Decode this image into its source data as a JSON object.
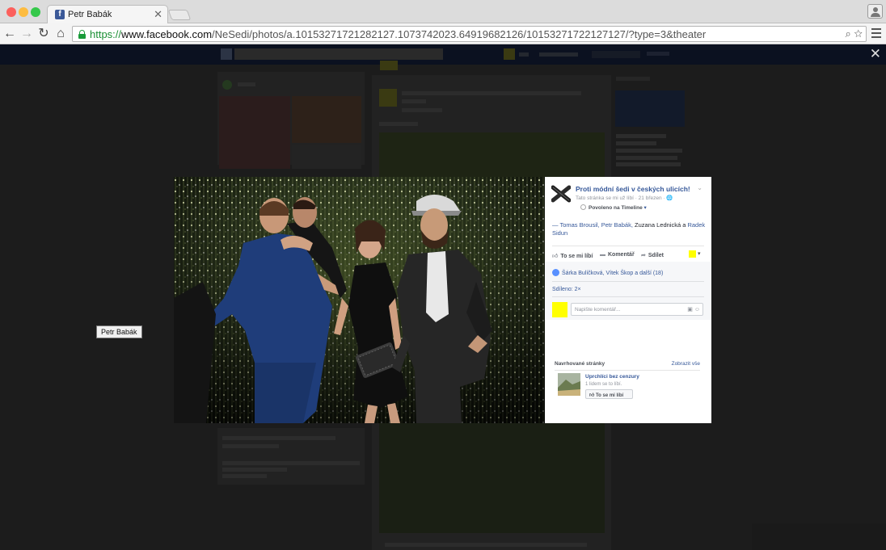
{
  "browser": {
    "tab_title": "Petr Babák",
    "tab_favicon": "f",
    "tab_close": "✕",
    "url_scheme": "https://",
    "url_host": "www.facebook.com",
    "url_path": "/NeSedi/photos/a.10153271721282127.1073742023.64919682126/10153271722127127/?type=3&theater",
    "colors": {
      "secure_green": "#1a9b3a",
      "link_blue": "#365899",
      "traffic_red": "#fc605c",
      "traffic_yellow": "#fdbc40",
      "traffic_green": "#34c84a"
    }
  },
  "icons": {
    "back": "←",
    "forward": "→",
    "reload": "↻",
    "home": "⌂",
    "search": "⌕",
    "bookmark": "☆",
    "close": "✕"
  },
  "page": {
    "name": "Proti módní šedi v českých ulicích!",
    "meta": "Tato stránka se mi už líbí · 21 březen · 🌐",
    "timeline_label": "Povoleno na Timeline",
    "timeline_caret": "▾",
    "tag_prefix": "— ",
    "tagged_links": [
      "Tomas Brousil, Petr Babák,"
    ],
    "tagged_text": " Zuzana Lednická a ",
    "tagged_last": "Radek Sidun"
  },
  "actions": {
    "like": "To se mi líbí",
    "comment": "Komentář",
    "share": "Sdílet"
  },
  "feedback": {
    "likes": "Šárka Bulíčková, Vítek Škop a další (18)",
    "shares": "Sdíleno: 2×",
    "comment_placeholder": "Napište komentář..."
  },
  "suggested": {
    "title": "Navrhované stránky",
    "see_all": "Zobrazit vše",
    "page_name": "Uprchlíci bez cenzury",
    "page_likes": "1 lidem se to líbí.",
    "like_button": "To se mi líbí"
  },
  "tooltip": "Petr Babák"
}
